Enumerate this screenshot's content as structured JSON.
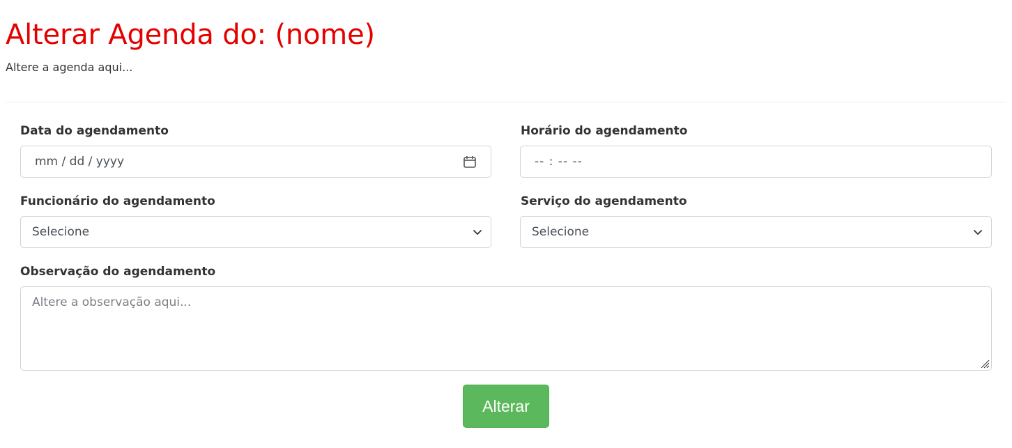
{
  "header": {
    "title": "Alterar Agenda do: (nome)",
    "subtitle": "Altere a agenda aqui..."
  },
  "colors": {
    "title": "#e50000",
    "button_bg": "#5cb85c",
    "button_text": "#ffffff",
    "border": "#ced4da"
  },
  "form": {
    "date": {
      "label": "Data do agendamento",
      "placeholder": "mm / dd / yyyy",
      "icon": "calendar-icon"
    },
    "time": {
      "label": "Horário do agendamento",
      "placeholder": "-- : --  --"
    },
    "employee": {
      "label": "Funcionário do agendamento",
      "selected": "Selecione",
      "icon": "chevron-down-icon"
    },
    "service": {
      "label": "Serviço do agendamento",
      "selected": "Selecione",
      "icon": "chevron-down-icon"
    },
    "notes": {
      "label": "Observação do agendamento",
      "placeholder": "Altere a observação aqui...",
      "icon": "resize-grip-icon"
    },
    "submit_label": "Alterar"
  }
}
